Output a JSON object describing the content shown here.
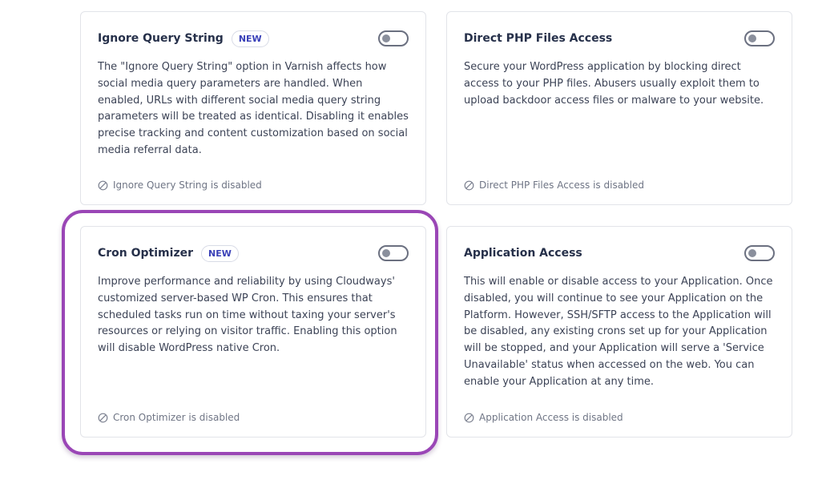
{
  "cards": [
    {
      "title": "Ignore Query String",
      "badge": "NEW",
      "description": "The \"Ignore Query String\" option in Varnish affects how social media query parameters are handled. When enabled, URLs with different social media query string parameters will be treated as identical. Disabling it enables precise tracking and content customization based on social media referral data.",
      "status": "Ignore Query String is disabled",
      "enabled": false
    },
    {
      "title": "Direct PHP Files Access",
      "badge": "",
      "description": "Secure your WordPress application by blocking direct access to your PHP files. Abusers usually exploit them to upload backdoor access files or malware to your website.",
      "status": "Direct PHP Files Access is disabled",
      "enabled": false
    },
    {
      "title": "Cron Optimizer",
      "badge": "NEW",
      "description": "Improve performance and reliability by using Cloudways' customized server-based WP Cron. This ensures that scheduled tasks run on time without taxing your server's resources or relying on visitor traffic. Enabling this option will disable WordPress native Cron.",
      "status": "Cron Optimizer is disabled",
      "enabled": false
    },
    {
      "title": "Application Access",
      "badge": "",
      "description": "This will enable or disable access to your Application. Once disabled, you will continue to see your Application on the Platform. However, SSH/SFTP access to the Application will be disabled, any existing crons set up for your Application will be stopped, and your Application will serve a 'Service Unavailable' status when accessed on the web. You can enable your Application at any time.",
      "status": "Application Access is disabled",
      "enabled": false
    }
  ],
  "colors": {
    "highlight_border": "#9a46b6",
    "badge_text": "#3a41b8",
    "title_text": "#26304a"
  },
  "icons": {
    "status": "disabled-circle-icon"
  }
}
